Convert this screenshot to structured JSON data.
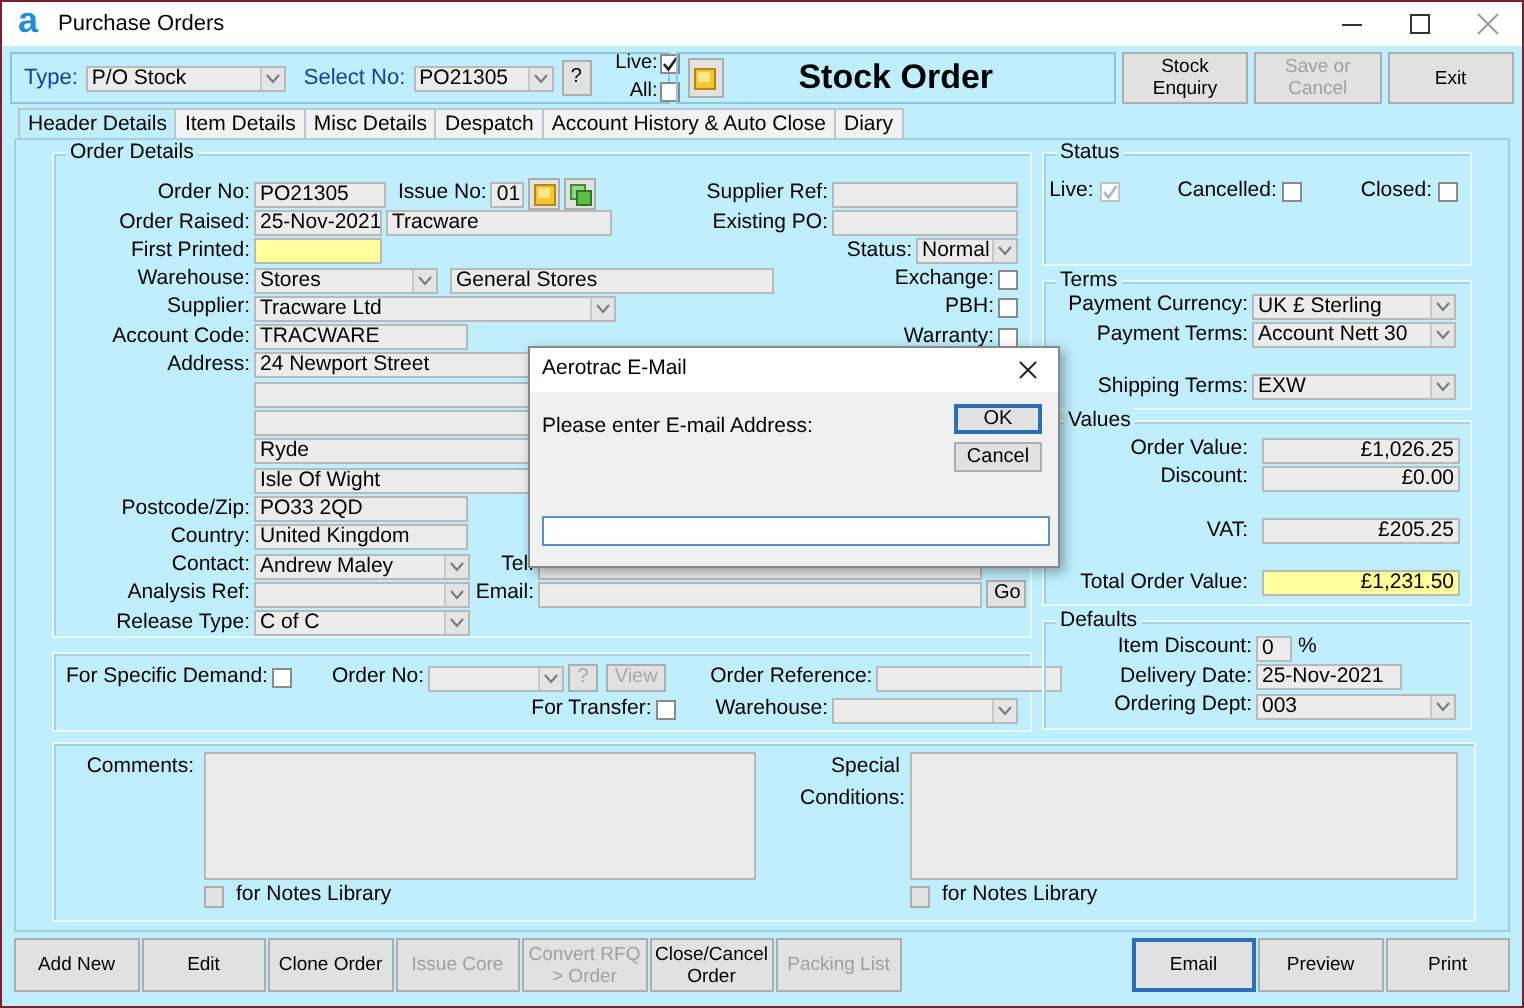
{
  "window": {
    "logo": "a",
    "title": "Purchase Orders"
  },
  "toolbar": {
    "type_label": "Type:",
    "type_value": "P/O Stock",
    "select_label": "Select No:",
    "select_value": "PO21305",
    "help": "?",
    "checks": [
      {
        "label": "Live:",
        "checked": true
      },
      {
        "label": "All:",
        "checked": false
      }
    ]
  },
  "heading": "Stock Order",
  "top_buttons": [
    {
      "label": "Stock Enquiry",
      "disabled": false
    },
    {
      "label": "Save or Cancel",
      "disabled": true
    },
    {
      "label": "Exit",
      "disabled": false
    }
  ],
  "tabs": [
    {
      "label": "Header Details",
      "selected": true
    },
    {
      "label": "Item Details",
      "selected": false
    },
    {
      "label": "Misc Details",
      "selected": false
    },
    {
      "label": "Despatch",
      "selected": false
    },
    {
      "label": "Account History & Auto Close",
      "selected": false
    },
    {
      "label": "Diary",
      "selected": false
    }
  ],
  "order_details": {
    "title": "Order Details",
    "rows": [
      {
        "label": "Order No:",
        "controls": [
          {
            "kind": "text",
            "value": "PO21305"
          },
          {
            "kind": "label",
            "text": "Issue No:"
          },
          {
            "kind": "text",
            "value": "01"
          },
          {
            "kind": "note"
          },
          {
            "kind": "copy"
          }
        ],
        "right": [
          {
            "kind": "label",
            "text": "Supplier Ref:"
          },
          {
            "kind": "text"
          }
        ]
      },
      {
        "label": "Order Raised:",
        "controls": [
          {
            "kind": "text",
            "value": "25-Nov-2021"
          },
          {
            "kind": "text",
            "value": "Tracware"
          }
        ],
        "right": [
          {
            "kind": "label",
            "text": "Existing PO:"
          },
          {
            "kind": "text"
          }
        ]
      },
      {
        "label": "First Printed:",
        "controls": [
          {
            "kind": "text",
            "highlight": true
          }
        ],
        "right": [
          {
            "kind": "label",
            "text": "Status:"
          },
          {
            "kind": "combo",
            "value": "Normal"
          }
        ]
      },
      {
        "label": "Warehouse:",
        "controls": [
          {
            "kind": "combo",
            "value": "Stores"
          },
          {
            "kind": "text",
            "value": "General Stores"
          }
        ],
        "right": [
          {
            "kind": "label",
            "text": "Exchange:"
          },
          {
            "kind": "check",
            "checked": false
          }
        ]
      },
      {
        "label": "Supplier:",
        "controls": [
          {
            "kind": "combo",
            "value": "Tracware Ltd"
          }
        ],
        "right": [
          {
            "kind": "label",
            "text": "PBH:"
          },
          {
            "kind": "check",
            "checked": false
          }
        ]
      },
      {
        "label": "Account Code:",
        "controls": [
          {
            "kind": "text",
            "value": "TRACWARE"
          }
        ],
        "right": [
          {
            "kind": "label",
            "text": "Warranty:"
          },
          {
            "kind": "check",
            "checked": false
          }
        ]
      },
      {
        "label": "Address:",
        "controls": [
          {
            "kind": "text",
            "value": "24 Newport Street"
          }
        ]
      },
      {
        "controls": [
          {
            "kind": "text"
          }
        ]
      },
      {
        "controls": [
          {
            "kind": "text"
          }
        ]
      },
      {
        "controls": [
          {
            "kind": "text",
            "value": "Ryde"
          }
        ]
      },
      {
        "controls": [
          {
            "kind": "text",
            "value": "Isle Of Wight"
          }
        ]
      },
      {
        "label": "Postcode/Zip:",
        "controls": [
          {
            "kind": "text",
            "value": "PO33 2QD"
          }
        ]
      },
      {
        "label": "Country:",
        "controls": [
          {
            "kind": "text",
            "value": "United Kingdom"
          }
        ]
      },
      {
        "label": "Contact:",
        "controls": [
          {
            "kind": "combo",
            "value": "Andrew Maley"
          },
          {
            "kind": "label",
            "text": "Tel:"
          },
          {
            "kind": "text"
          }
        ]
      },
      {
        "label": "Analysis Ref:",
        "controls": [
          {
            "kind": "combo"
          },
          {
            "kind": "label",
            "text": "Email:"
          },
          {
            "kind": "text"
          },
          {
            "kind": "button",
            "text": "Go",
            "disabled": false
          }
        ]
      },
      {
        "label": "Release Type:",
        "controls": [
          {
            "kind": "combo",
            "value": "C of C"
          }
        ]
      }
    ]
  },
  "demand": {
    "items": [
      {
        "kind": "label",
        "text": "For Specific Demand:"
      },
      {
        "kind": "check",
        "checked": false
      },
      {
        "kind": "label",
        "text": "Order No:"
      },
      {
        "kind": "combo"
      },
      {
        "kind": "button",
        "text": "?",
        "disabled": true
      },
      {
        "kind": "button",
        "text": "View",
        "disabled": true
      },
      {
        "kind": "label",
        "text": "Order Reference:"
      },
      {
        "kind": "text"
      },
      {
        "kind": "label",
        "text": "For Transfer:"
      },
      {
        "kind": "check",
        "checked": false
      },
      {
        "kind": "label",
        "text": "Warehouse:"
      },
      {
        "kind": "combo"
      }
    ]
  },
  "status": {
    "title": "Status",
    "checks": [
      {
        "label": "Live:",
        "checked": true,
        "disabled": true
      },
      {
        "label": "Cancelled:",
        "checked": false,
        "disabled": false
      },
      {
        "label": "Closed:",
        "checked": false,
        "disabled": false
      }
    ]
  },
  "terms": {
    "title": "Terms",
    "rows": [
      {
        "label": "Payment Currency:",
        "value": "UK £ Sterling"
      },
      {
        "label": "Payment Terms:",
        "value": "Account Nett 30"
      },
      {
        "label": "Shipping Terms:",
        "value": "EXW"
      }
    ]
  },
  "values": {
    "title": "Values",
    "rows": [
      {
        "label": "Order Value:",
        "value": "£1,026.25",
        "highlight": false
      },
      {
        "label": "Discount:",
        "value": "£0.00",
        "highlight": false
      },
      {
        "label": "VAT:",
        "value": "£205.25",
        "highlight": false
      },
      {
        "label": "Total Order Value:",
        "value": "£1,231.50",
        "highlight": true
      }
    ]
  },
  "defaults": {
    "title": "Defaults",
    "rows": [
      {
        "label": "Item Discount:",
        "controls": [
          {
            "kind": "text",
            "value": "0"
          },
          {
            "kind": "unit",
            "text": "%"
          }
        ]
      },
      {
        "label": "Delivery Date:",
        "controls": [
          {
            "kind": "text",
            "value": "25-Nov-2021"
          }
        ]
      },
      {
        "label": "Ordering Dept:",
        "controls": [
          {
            "kind": "combo",
            "value": "003"
          }
        ]
      }
    ]
  },
  "notes": [
    {
      "label": "Comments:",
      "library": "for Notes Library"
    },
    {
      "label": "Special Conditions:",
      "library": "for Notes Library"
    }
  ],
  "bottom_buttons": [
    {
      "label": "Add New",
      "disabled": false,
      "focused": false
    },
    {
      "label": "Edit",
      "disabled": false,
      "focused": false
    },
    {
      "label": "Clone Order",
      "disabled": false,
      "focused": false
    },
    {
      "label": "Issue Core",
      "disabled": true,
      "focused": false
    },
    {
      "label": "Convert RFQ > Order",
      "disabled": true,
      "focused": false
    },
    {
      "label": "Close/Cancel Order",
      "disabled": false,
      "focused": false
    },
    {
      "label": "Packing List",
      "disabled": true,
      "focused": false
    },
    {
      "label": "Email",
      "disabled": false,
      "focused": true
    },
    {
      "label": "Preview",
      "disabled": false,
      "focused": false
    },
    {
      "label": "Print",
      "disabled": false,
      "focused": false
    }
  ],
  "dialog": {
    "title": "Aerotrac E-Mail",
    "message": "Please enter E-mail Address:",
    "buttons": [
      {
        "label": "OK",
        "default": true
      },
      {
        "label": "Cancel",
        "default": false
      }
    ]
  }
}
